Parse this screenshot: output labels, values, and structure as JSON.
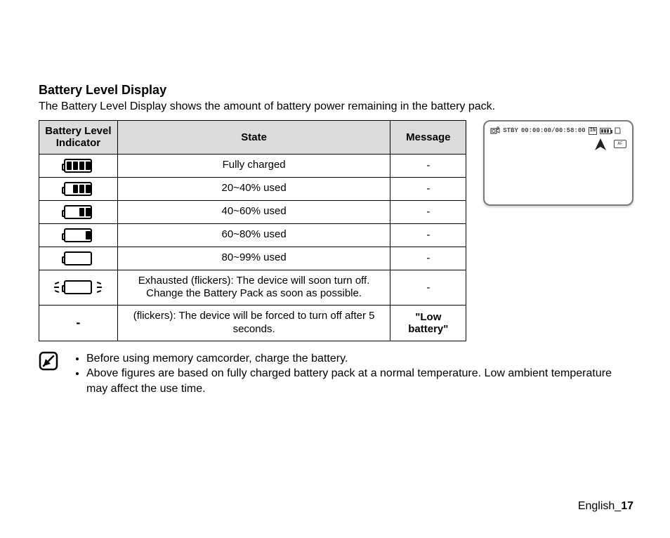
{
  "title": "Battery Level Display",
  "intro": "The Battery Level Display shows the amount of battery power remaining in the battery pack.",
  "table": {
    "headers": {
      "indicator": "Battery Level Indicator",
      "state": "State",
      "message": "Message"
    },
    "rows": [
      {
        "icon": "battery-4",
        "state": "Fully charged",
        "message": "-"
      },
      {
        "icon": "battery-3",
        "state": "20~40% used",
        "message": "-"
      },
      {
        "icon": "battery-2",
        "state": "40~60% used",
        "message": "-"
      },
      {
        "icon": "battery-1",
        "state": "60~80% used",
        "message": "-"
      },
      {
        "icon": "battery-0",
        "state": "80~99% used",
        "message": "-"
      },
      {
        "icon": "battery-flicker",
        "state": "Exhausted (flickers): The device will soon turn off. Change the Battery Pack as soon as possible.",
        "message": "-"
      },
      {
        "icon": "dash",
        "state": "(flickers): The device will be forced to turn off after 5 seconds.",
        "message": "\"Low battery\"",
        "message_bold": true
      }
    ]
  },
  "notes": [
    "Before using memory camcorder, charge the battery.",
    "Above figures are based on fully charged battery pack at a normal temperature. Low ambient temperature may affect the use time."
  ],
  "display": {
    "stby": "STBY",
    "time": "00:00:00/00:58:00",
    "in": "IN",
    "af": "AF"
  },
  "footer": {
    "lang": "English",
    "sep": "_",
    "page": "17"
  }
}
